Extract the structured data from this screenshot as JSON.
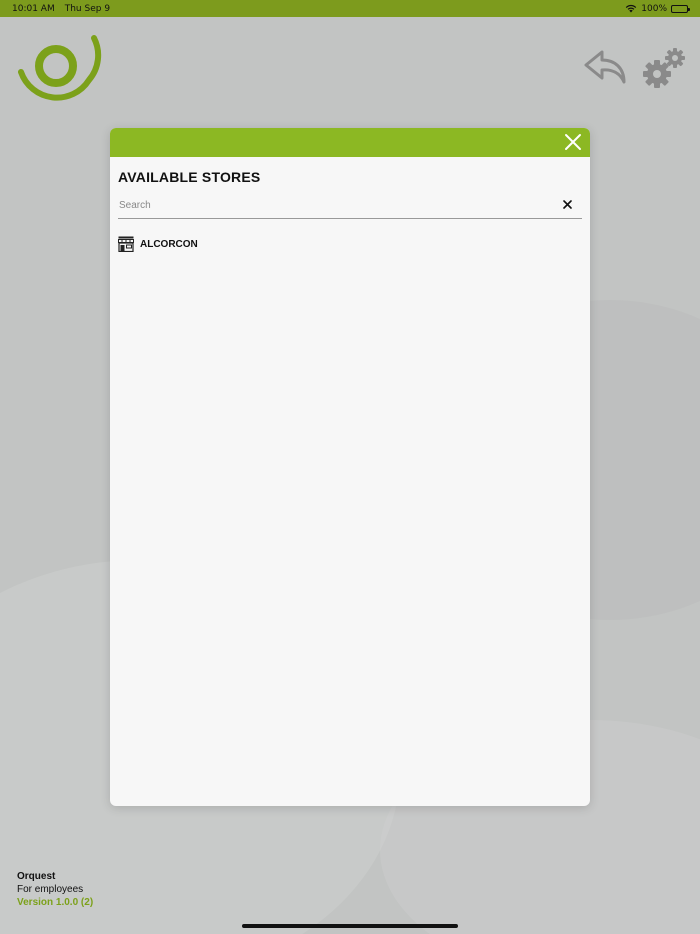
{
  "status_bar": {
    "time": "10:01 AM",
    "date": "Thu Sep 9",
    "battery": "100%",
    "background_color": "#7d9b1d"
  },
  "header": {
    "logo_icon": "orquest-swirl-logo",
    "back_icon": "reply-arrow-icon",
    "settings_icon": "gears-icon"
  },
  "modal": {
    "accent_color": "#8cb823",
    "title": "AVAILABLE STORES",
    "search": {
      "placeholder": "Search",
      "value": ""
    },
    "stores": [
      {
        "label": "ALCORCON",
        "icon": "store-icon"
      }
    ]
  },
  "footer": {
    "app_name": "Orquest",
    "tagline": "For employees",
    "version": "Version 1.0.0 (2)",
    "version_color": "#7ca11a"
  }
}
